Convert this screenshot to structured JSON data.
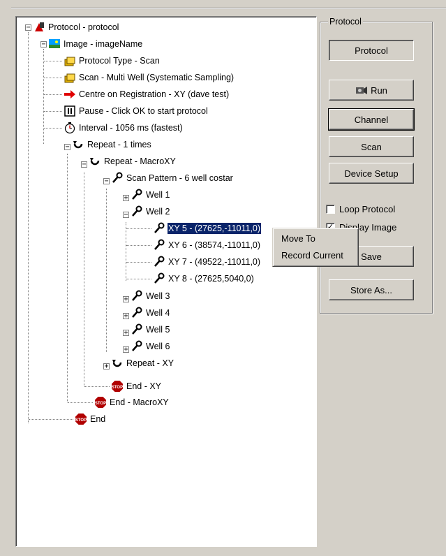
{
  "tree": {
    "nodes": [
      {
        "label": "Protocol - protocol",
        "icon": "protocol-icon"
      },
      {
        "label": "Image - imageName",
        "icon": "image-icon"
      },
      {
        "label": "Protocol Type - Scan",
        "icon": "folder-stack-icon"
      },
      {
        "label": "Scan - Multi Well (Systematic Sampling)",
        "icon": "folder-stack-icon"
      },
      {
        "label": "Centre on Registration - XY (dave test)",
        "icon": "red-arrow-icon"
      },
      {
        "label": "Pause - Click OK to start protocol",
        "icon": "pause-icon"
      },
      {
        "label": "Interval - 1056 ms (fastest)",
        "icon": "stopwatch-icon"
      },
      {
        "label": "Repeat - 1 times",
        "icon": "repeat-icon"
      },
      {
        "label": "Repeat - MacroXY",
        "icon": "repeat-icon"
      },
      {
        "label": "Scan Pattern - 6 well costar",
        "icon": "wrench-icon"
      },
      {
        "label": "Well 1",
        "icon": "wrench-icon"
      },
      {
        "label": "Well 2",
        "icon": "wrench-icon"
      },
      {
        "label": "XY 5 - (27625,-11011,0)",
        "icon": "wrench-icon"
      },
      {
        "label": "XY 6 - (38574,-11011,0)",
        "icon": "wrench-icon"
      },
      {
        "label": "XY 7 - (49522,-11011,0)",
        "icon": "wrench-icon"
      },
      {
        "label": "XY 8 - (27625,5040,0)",
        "icon": "wrench-icon"
      },
      {
        "label": "Well 3",
        "icon": "wrench-icon"
      },
      {
        "label": "Well 4",
        "icon": "wrench-icon"
      },
      {
        "label": "Well 5",
        "icon": "wrench-icon"
      },
      {
        "label": "Well 6",
        "icon": "wrench-icon"
      },
      {
        "label": "Repeat - XY",
        "icon": "repeat-icon"
      },
      {
        "label": "End - XY",
        "icon": "stop-sign-icon"
      },
      {
        "label": "End - MacroXY",
        "icon": "stop-sign-icon"
      },
      {
        "label": "End",
        "icon": "stop-sign-icon"
      }
    ]
  },
  "panel": {
    "title": "Protocol",
    "buttons": {
      "protocol": "Protocol",
      "run": "Run",
      "channel": "Channel",
      "scan": "Scan",
      "device_setup": "Device Setup",
      "save": "Save",
      "store_as": "Store As..."
    },
    "checkboxes": {
      "loop_protocol": {
        "label": "Loop Protocol",
        "checked": false
      },
      "display_image": {
        "label": "Display Image",
        "checked": true
      }
    }
  },
  "context_menu": {
    "items": [
      "Move To",
      "Record Current"
    ]
  },
  "colors": {
    "selection": "#0a246a",
    "face": "#d4d0c8"
  }
}
